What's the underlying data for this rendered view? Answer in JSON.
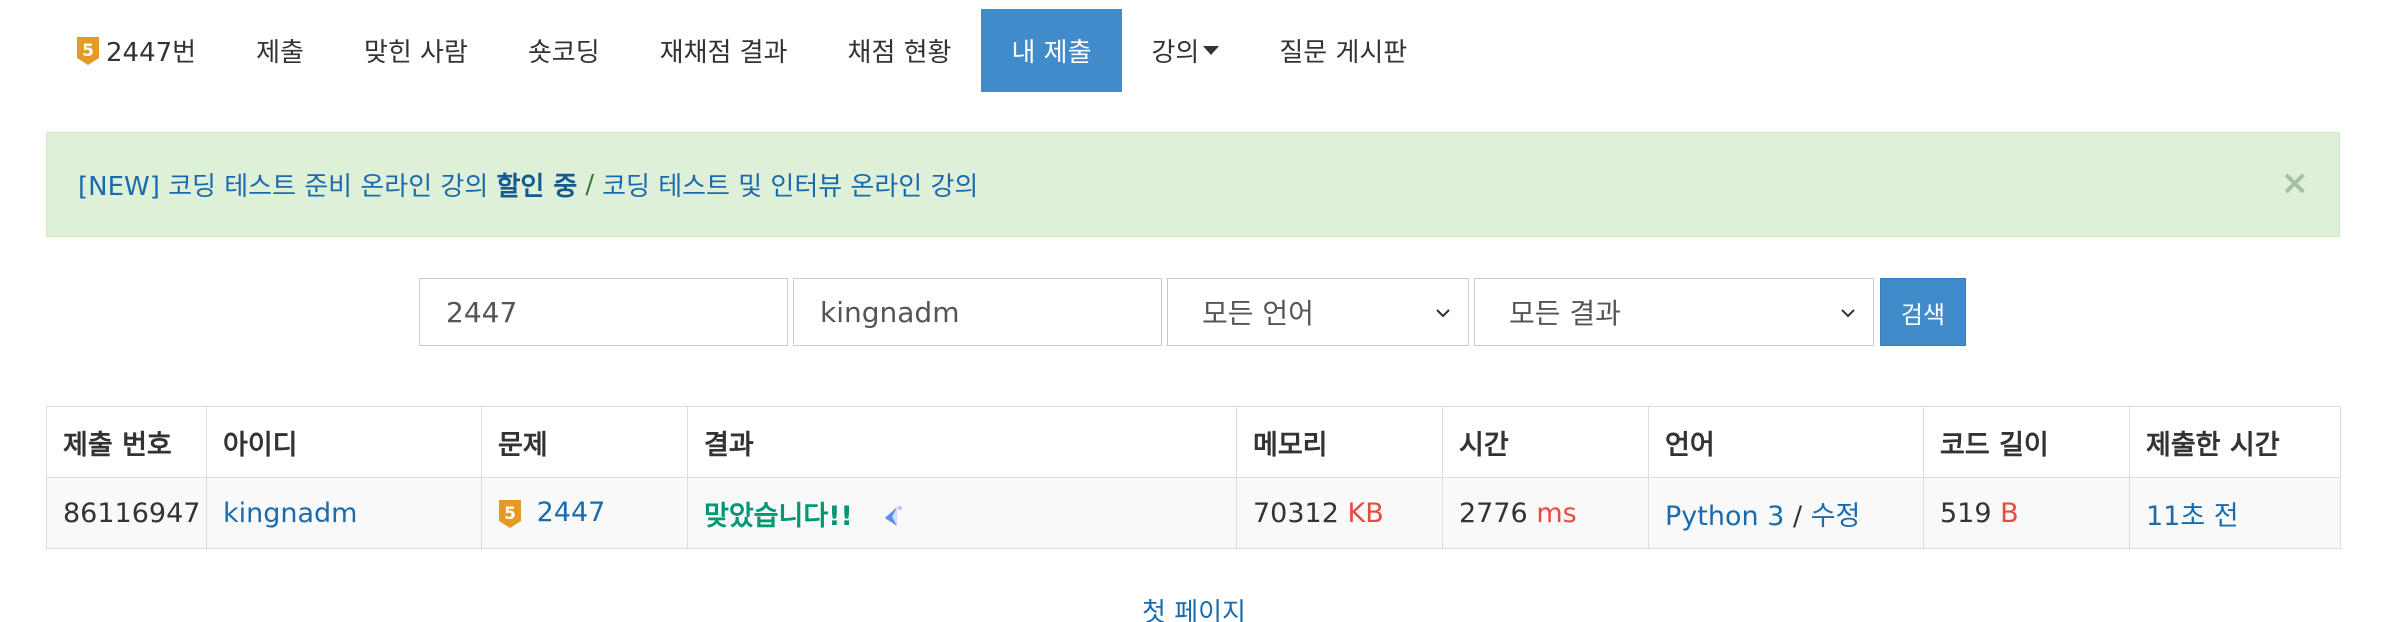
{
  "nav": {
    "problem_label": "2447번",
    "problem_tier": "5",
    "submit": "제출",
    "solvers": "맞힌 사람",
    "shortcoding": "숏코딩",
    "rejudge_result": "재채점 결과",
    "judge_status": "채점 현황",
    "my_submissions": "내 제출",
    "lectures": "강의",
    "qna_board": "질문 게시판",
    "accent_color": "#428bca"
  },
  "alert": {
    "prefix": "[NEW] 코딩 테스트 준비 온라인 강의",
    "highlight": "할인 중",
    "separator": "/",
    "suffix": "코딩 테스트 및 인터뷰 온라인 강의",
    "close": "×"
  },
  "search": {
    "problem_id": "2447",
    "user_id": "kingnadm",
    "language": "모든 언어",
    "result": "모든 결과",
    "button": "검색"
  },
  "table": {
    "headers": [
      "제출 번호",
      "아이디",
      "문제",
      "결과",
      "메모리",
      "시간",
      "언어",
      "코드 길이",
      "제출한 시간"
    ],
    "rows": [
      {
        "submission_id": "86116947",
        "user": "kingnadm",
        "problem_tier": "5",
        "problem": "2447",
        "result": "맞았습니다!!",
        "memory": "70312",
        "memory_unit": "KB",
        "time": "2776",
        "time_unit": "ms",
        "language": "Python 3",
        "language_sep": "/",
        "edit": "수정",
        "code_length": "519",
        "code_length_unit": "B",
        "submitted_at": "11초 전"
      }
    ]
  },
  "pagination": {
    "first_page": "첫 페이지"
  },
  "colors": {
    "link": "#1a6bad",
    "unit": "#e74c3c",
    "accepted": "#009874",
    "tier_bronze": "#e39b25"
  }
}
